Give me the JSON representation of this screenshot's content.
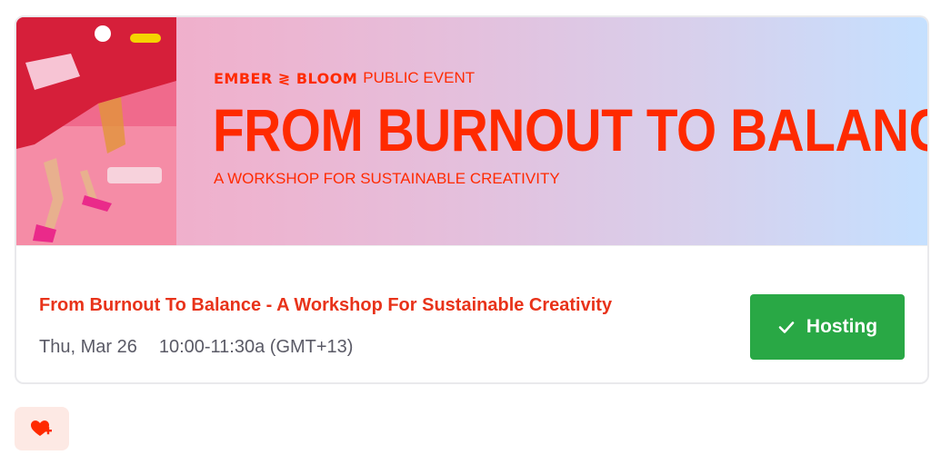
{
  "banner": {
    "brand_logo": "EMBER ≷ BLOOM",
    "brand_event_label": "PUBLIC EVENT",
    "headline": "FROM BURNOUT TO BALANCE -",
    "subheadline": "A WORKSHOP FOR SUSTAINABLE CREATIVITY",
    "photo_icon": "event-photo",
    "gradient_colors": [
      "#f3a8c4",
      "#e4c0dd",
      "#c5e0ff"
    ],
    "accent_color": "#ff2a00"
  },
  "event": {
    "title": "From Burnout To Balance - A Workshop For Sustainable Creativity",
    "date": "Thu, Mar 26",
    "time": "10:00-11:30a (GMT+13)",
    "title_color": "#e8331a"
  },
  "hosting_button": {
    "label": "Hosting",
    "icon": "checkmark-icon",
    "color": "#29a845"
  },
  "favorite_button": {
    "icon": "heart-plus-icon",
    "background": "#fde9e4",
    "icon_color": "#ff2a00"
  }
}
